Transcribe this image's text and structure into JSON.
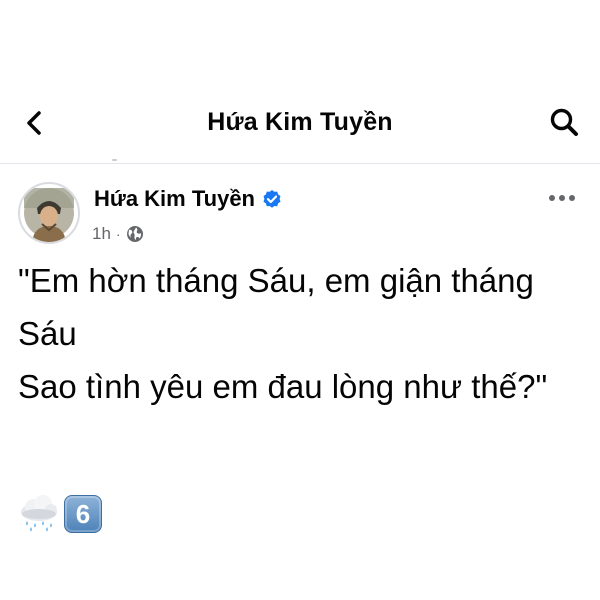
{
  "header": {
    "title": "Hứa Kim Tuyền",
    "back_icon": "chevron-left-icon",
    "search_icon": "search-icon"
  },
  "post": {
    "author": "Hứa Kim Tuyền",
    "verified": true,
    "time": "1h",
    "separator": "·",
    "audience_icon": "globe-icon",
    "more_icon": "more-horizontal-icon",
    "text": "\"Em hờn tháng Sáu, em giận tháng Sáu\nSao tình yêu em đau lòng như thế?\"",
    "emojis": [
      {
        "name": "cloud-with-rain-emoji",
        "label": ""
      },
      {
        "name": "keycap-six-emoji",
        "label": "6"
      }
    ]
  },
  "colors": {
    "text": "#050505",
    "secondary_text": "#65676b",
    "verified_blue": "#1877f2",
    "divider": "#e4e6eb"
  }
}
